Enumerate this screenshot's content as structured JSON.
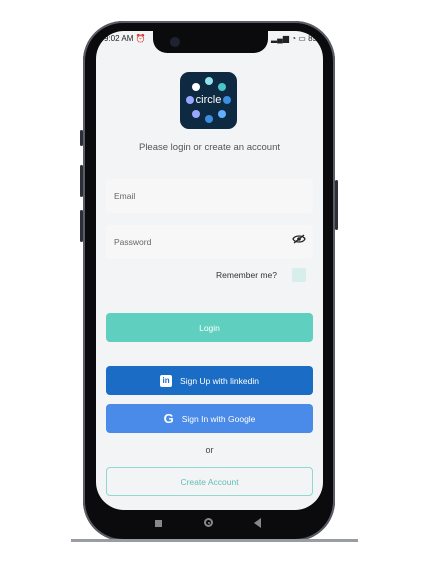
{
  "status": {
    "time": "9:02 AM",
    "alarm_icon": "alarm-icon",
    "battery": "85"
  },
  "app": {
    "logo_text": "circle",
    "logo_bg": "#0e2a43",
    "logo_dot_colors": [
      "#8ee3ef",
      "#48c6c9",
      "#3b8ee0",
      "#9aa7ff",
      "#5fb0ff",
      "#ffffff"
    ]
  },
  "login": {
    "subtitle": "Please login or create an account",
    "email_placeholder": "Email",
    "password_placeholder": "Password",
    "remember_label": "Remember me?",
    "login_label": "Login",
    "linkedin_label": "Sign Up with linkedin",
    "google_label": "Sign In with Google",
    "or_label": "or",
    "create_label": "Create Account"
  },
  "colors": {
    "login": "#5fcfc0",
    "linkedin": "#1b6cc4",
    "google": "#4a8ae8",
    "accent": "#8fd9cf"
  }
}
